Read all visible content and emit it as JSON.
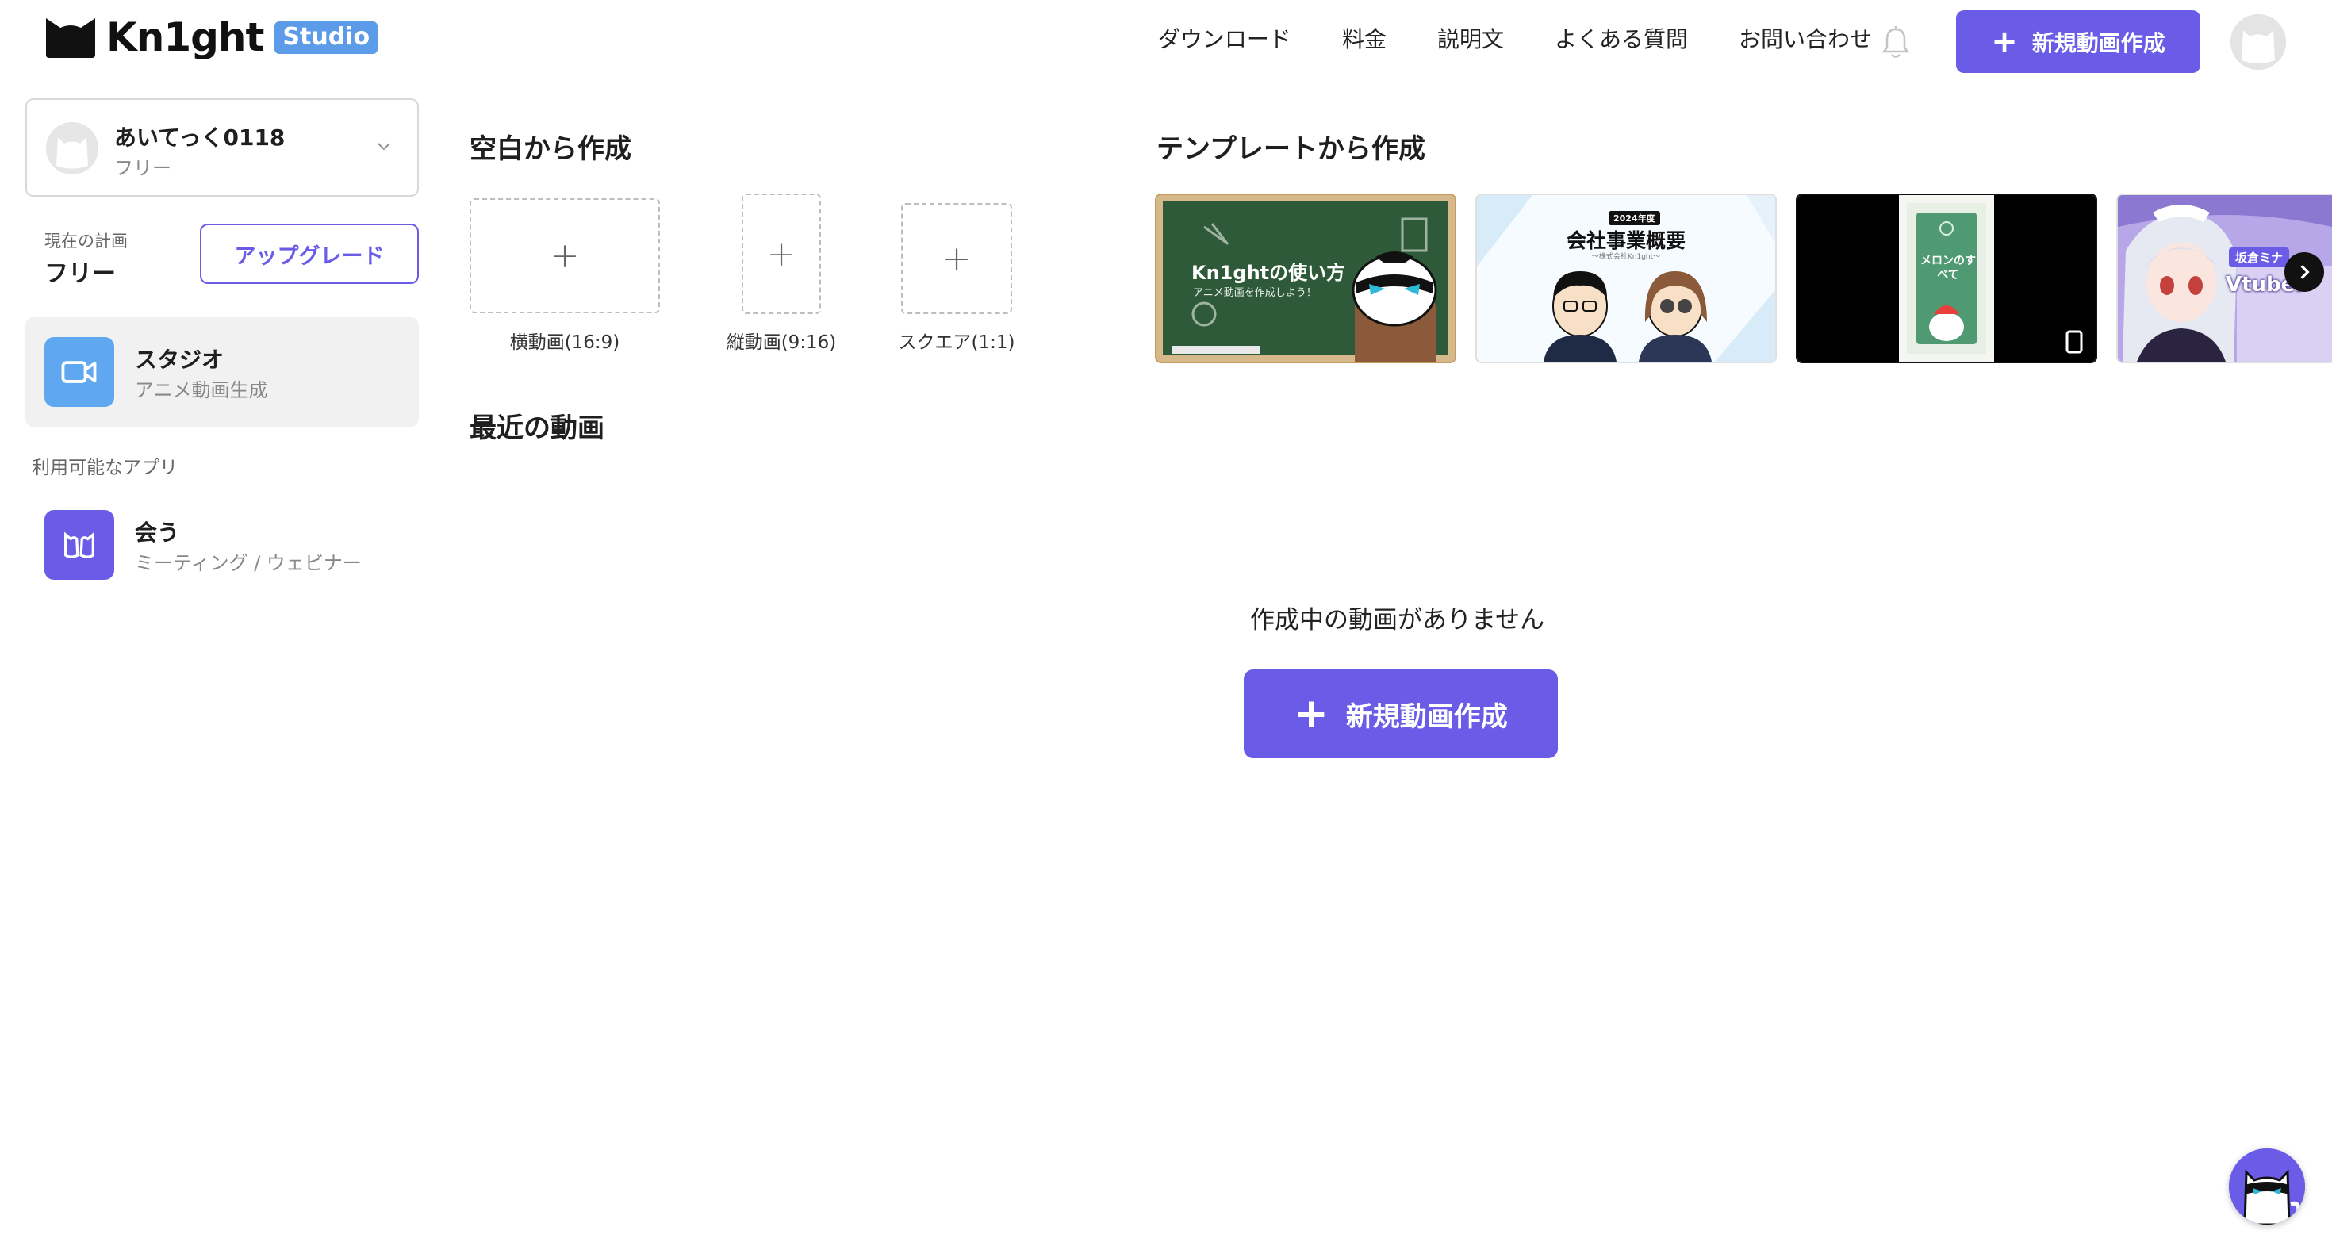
{
  "brand": {
    "name": "Kn1ght",
    "badge": "Studio"
  },
  "nav": {
    "items": [
      {
        "label": "ダウンロード"
      },
      {
        "label": "料金"
      },
      {
        "label": "説明文"
      },
      {
        "label": "よくある質問"
      },
      {
        "label": "お問い合わせ"
      }
    ],
    "cta_label": "新規動画作成"
  },
  "account": {
    "name": "あいてっく0118",
    "plan": "フリー"
  },
  "plan": {
    "label": "現在の計画",
    "value": "フリー",
    "upgrade_label": "アップグレード"
  },
  "apps": {
    "studio": {
      "title": "スタジオ",
      "subtitle": "アニメ動画生成"
    },
    "available_label": "利用可能なアプリ",
    "meet": {
      "title": "会う",
      "subtitle": "ミーティング / ウェビナー"
    }
  },
  "blank": {
    "title": "空白から作成",
    "options": [
      {
        "label": "横動画(16:9)"
      },
      {
        "label": "縦動画(9:16)"
      },
      {
        "label": "スクエア(1:1)"
      }
    ]
  },
  "templates": {
    "title": "テンプレートから作成",
    "items": [
      {
        "title": "Kn1ghtの使い方",
        "subtitle": "アニメ動画を作成しよう！"
      },
      {
        "title": "会社事業概要",
        "tag": "2024年度",
        "subtitle": "〜株式会社Kn1ght〜"
      },
      {
        "title": "メロンのすべて",
        "subtitle": ""
      },
      {
        "title": "Vtuber",
        "name": "坂倉ミナ"
      }
    ]
  },
  "recent": {
    "title": "最近の動画",
    "empty_text": "作成中の動画がありません",
    "cta_label": "新規動画作成"
  },
  "colors": {
    "accent": "#6b5ce7",
    "studio_icon": "#5fa8f0",
    "badge": "#5b9be8"
  }
}
